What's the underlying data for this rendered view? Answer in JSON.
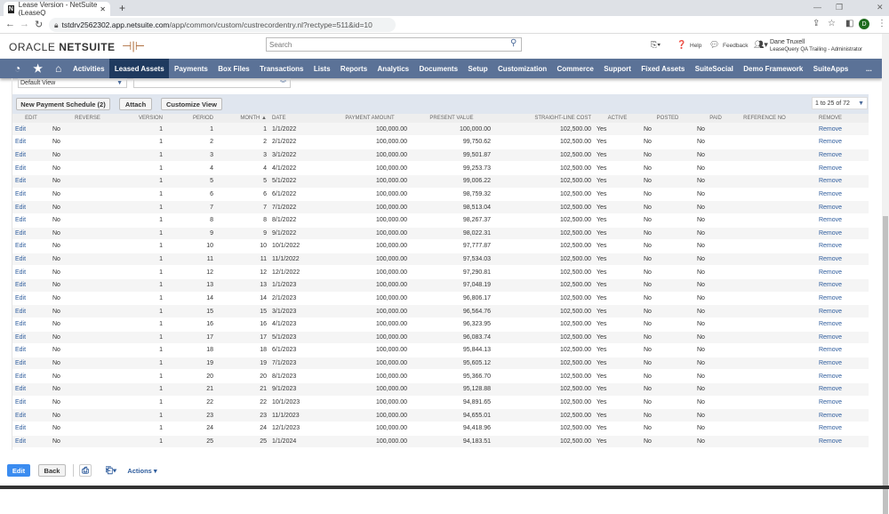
{
  "browser": {
    "tab_title": "Lease Version - NetSuite (LeaseQ",
    "url_host": "tstdrv2562302.app.netsuite.com",
    "url_path": "/app/common/custom/custrecordentry.nl?rectype=511&id=10",
    "profile_initial": "D"
  },
  "header": {
    "logo_oracle": "ORACLE",
    "logo_netsuite": "NETSUITE",
    "search_placeholder": "Search",
    "help": "Help",
    "feedback": "Feedback",
    "user_name": "Dane Truxell",
    "user_role": "LeaseQuery QA Trailing - Administrator"
  },
  "menu": [
    "Activities",
    "Leased Assets",
    "Payments",
    "Box Files",
    "Transactions",
    "Lists",
    "Reports",
    "Analytics",
    "Documents",
    "Setup",
    "Customization",
    "Commerce",
    "Support",
    "Fixed Assets",
    "SuiteSocial",
    "Demo Framework",
    "SuiteApps",
    "..."
  ],
  "menu_active": "Leased Assets",
  "sublist": {
    "view": "Default View",
    "buttons": {
      "new_schedule": "New Payment Schedule (2)",
      "attach": "Attach",
      "customize": "Customize View"
    },
    "pager": "1 to 25 of 72",
    "columns": [
      "EDIT",
      "REVERSE",
      "VERSION",
      "PERIOD",
      "MONTH ▲",
      "DATE",
      "PAYMENT AMOUNT",
      "PRESENT VALUE",
      "STRAIGHT-LINE COST",
      "ACTIVE",
      "POSTED",
      "PAID",
      "REFERENCE NO",
      "REMOVE"
    ],
    "rows": [
      [
        "Edit",
        "No",
        "1",
        "1",
        "1",
        "1/1/2022",
        "100,000.00",
        "100,000.00",
        "102,500.00",
        "Yes",
        "No",
        "No",
        "",
        "Remove"
      ],
      [
        "Edit",
        "No",
        "1",
        "2",
        "2",
        "2/1/2022",
        "100,000.00",
        "99,750.62",
        "102,500.00",
        "Yes",
        "No",
        "No",
        "",
        "Remove"
      ],
      [
        "Edit",
        "No",
        "1",
        "3",
        "3",
        "3/1/2022",
        "100,000.00",
        "99,501.87",
        "102,500.00",
        "Yes",
        "No",
        "No",
        "",
        "Remove"
      ],
      [
        "Edit",
        "No",
        "1",
        "4",
        "4",
        "4/1/2022",
        "100,000.00",
        "99,253.73",
        "102,500.00",
        "Yes",
        "No",
        "No",
        "",
        "Remove"
      ],
      [
        "Edit",
        "No",
        "1",
        "5",
        "5",
        "5/1/2022",
        "100,000.00",
        "99,006.22",
        "102,500.00",
        "Yes",
        "No",
        "No",
        "",
        "Remove"
      ],
      [
        "Edit",
        "No",
        "1",
        "6",
        "6",
        "6/1/2022",
        "100,000.00",
        "98,759.32",
        "102,500.00",
        "Yes",
        "No",
        "No",
        "",
        "Remove"
      ],
      [
        "Edit",
        "No",
        "1",
        "7",
        "7",
        "7/1/2022",
        "100,000.00",
        "98,513.04",
        "102,500.00",
        "Yes",
        "No",
        "No",
        "",
        "Remove"
      ],
      [
        "Edit",
        "No",
        "1",
        "8",
        "8",
        "8/1/2022",
        "100,000.00",
        "98,267.37",
        "102,500.00",
        "Yes",
        "No",
        "No",
        "",
        "Remove"
      ],
      [
        "Edit",
        "No",
        "1",
        "9",
        "9",
        "9/1/2022",
        "100,000.00",
        "98,022.31",
        "102,500.00",
        "Yes",
        "No",
        "No",
        "",
        "Remove"
      ],
      [
        "Edit",
        "No",
        "1",
        "10",
        "10",
        "10/1/2022",
        "100,000.00",
        "97,777.87",
        "102,500.00",
        "Yes",
        "No",
        "No",
        "",
        "Remove"
      ],
      [
        "Edit",
        "No",
        "1",
        "11",
        "11",
        "11/1/2022",
        "100,000.00",
        "97,534.03",
        "102,500.00",
        "Yes",
        "No",
        "No",
        "",
        "Remove"
      ],
      [
        "Edit",
        "No",
        "1",
        "12",
        "12",
        "12/1/2022",
        "100,000.00",
        "97,290.81",
        "102,500.00",
        "Yes",
        "No",
        "No",
        "",
        "Remove"
      ],
      [
        "Edit",
        "No",
        "1",
        "13",
        "13",
        "1/1/2023",
        "100,000.00",
        "97,048.19",
        "102,500.00",
        "Yes",
        "No",
        "No",
        "",
        "Remove"
      ],
      [
        "Edit",
        "No",
        "1",
        "14",
        "14",
        "2/1/2023",
        "100,000.00",
        "96,806.17",
        "102,500.00",
        "Yes",
        "No",
        "No",
        "",
        "Remove"
      ],
      [
        "Edit",
        "No",
        "1",
        "15",
        "15",
        "3/1/2023",
        "100,000.00",
        "96,564.76",
        "102,500.00",
        "Yes",
        "No",
        "No",
        "",
        "Remove"
      ],
      [
        "Edit",
        "No",
        "1",
        "16",
        "16",
        "4/1/2023",
        "100,000.00",
        "96,323.95",
        "102,500.00",
        "Yes",
        "No",
        "No",
        "",
        "Remove"
      ],
      [
        "Edit",
        "No",
        "1",
        "17",
        "17",
        "5/1/2023",
        "100,000.00",
        "96,083.74",
        "102,500.00",
        "Yes",
        "No",
        "No",
        "",
        "Remove"
      ],
      [
        "Edit",
        "No",
        "1",
        "18",
        "18",
        "6/1/2023",
        "100,000.00",
        "95,844.13",
        "102,500.00",
        "Yes",
        "No",
        "No",
        "",
        "Remove"
      ],
      [
        "Edit",
        "No",
        "1",
        "19",
        "19",
        "7/1/2023",
        "100,000.00",
        "95,605.12",
        "102,500.00",
        "Yes",
        "No",
        "No",
        "",
        "Remove"
      ],
      [
        "Edit",
        "No",
        "1",
        "20",
        "20",
        "8/1/2023",
        "100,000.00",
        "95,366.70",
        "102,500.00",
        "Yes",
        "No",
        "No",
        "",
        "Remove"
      ],
      [
        "Edit",
        "No",
        "1",
        "21",
        "21",
        "9/1/2023",
        "100,000.00",
        "95,128.88",
        "102,500.00",
        "Yes",
        "No",
        "No",
        "",
        "Remove"
      ],
      [
        "Edit",
        "No",
        "1",
        "22",
        "22",
        "10/1/2023",
        "100,000.00",
        "94,891.65",
        "102,500.00",
        "Yes",
        "No",
        "No",
        "",
        "Remove"
      ],
      [
        "Edit",
        "No",
        "1",
        "23",
        "23",
        "11/1/2023",
        "100,000.00",
        "94,655.01",
        "102,500.00",
        "Yes",
        "No",
        "No",
        "",
        "Remove"
      ],
      [
        "Edit",
        "No",
        "1",
        "24",
        "24",
        "12/1/2023",
        "100,000.00",
        "94,418.96",
        "102,500.00",
        "Yes",
        "No",
        "No",
        "",
        "Remove"
      ],
      [
        "Edit",
        "No",
        "1",
        "25",
        "25",
        "1/1/2024",
        "100,000.00",
        "94,183.51",
        "102,500.00",
        "Yes",
        "No",
        "No",
        "",
        "Remove"
      ]
    ]
  },
  "footer": {
    "edit": "Edit",
    "back": "Back",
    "actions": "Actions ▾"
  },
  "colors": {
    "menu_bg": "#5b7297",
    "menu_active": "#1f3a5f",
    "primary_button": "#3b8cf0",
    "link": "#2f5d9d"
  }
}
